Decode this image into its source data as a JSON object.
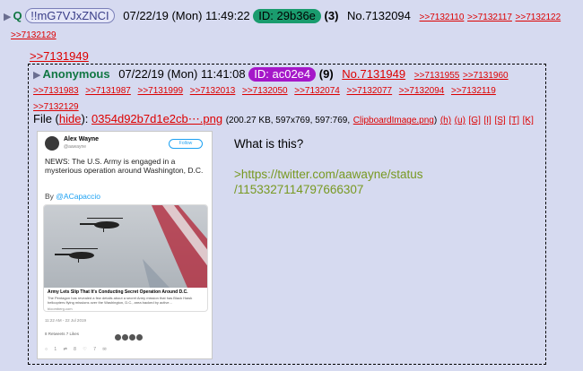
{
  "post": {
    "q_label": "Q",
    "tripcode": "!!mG7VJxZNCI",
    "date": "07/22/19 (Mon) 11:49:22",
    "id_label": "ID: 29b36e",
    "id_count": "(3)",
    "number": "No.7132094",
    "backlinks": [
      ">>7132110",
      ">>7132117",
      ">>7132122",
      ">>7132129"
    ],
    "quote_link": ">>7131949"
  },
  "quoted": {
    "name": "Anonymous",
    "date": "07/22/19 (Mon) 11:41:08",
    "id_label": "ID: ac02e4",
    "id_count": "(9)",
    "number": "No.7131949",
    "backlinks": [
      ">>7131955",
      ">>7131960",
      ">>7131983",
      ">>7131987",
      ">>7131999",
      ">>7132013",
      ">>7132050",
      ">>7132074",
      ">>7132077",
      ">>7132094",
      ">>7132119",
      ">>7132129"
    ],
    "file": {
      "prefix": "File (",
      "hide": "hide",
      "suffix": "):",
      "filename": "0354d92b7d1e2cb⋯.png",
      "meta_open": "(200.27 KB, 597x769, 597:769,",
      "original_name": "ClipboardImage.png",
      "meta_close": ")",
      "tools": [
        "(h)",
        "(u)",
        "[G]",
        "[I]",
        "[S]",
        "[T]",
        "[K]"
      ]
    },
    "comment_line1": "What is this?",
    "comment_link_line1": ">https://twitter.com/aawayne/status",
    "comment_link_line2": "/1153327114797666307"
  },
  "tweet": {
    "author": "Alex Wayne",
    "handle": "@aawayne",
    "follow_label": "Follow",
    "text": "NEWS: The U.S. Army is engaged in a mysterious operation around Washington, D.C.",
    "by_prefix": "By ",
    "by_handle": "@ACapaccio",
    "card_title": "Army Lets Slip That It's Conducting Secret Operation Around D.C.",
    "card_desc": "The Pentagon has revealed a few details about a secret Army mission that has Black Hawk helicopters flying missions over the Washington, D.C., area backed by active...",
    "card_site": "bloomberg.com",
    "time": "11:22 AM - 22 Jul 2019",
    "stats": "8 Retweets  7 Likes",
    "actions": "○ 1   ⇄ 8   ♡ 7   ✉"
  },
  "colors": {
    "background": "#d6daf0",
    "link": "#dd0000",
    "name": "#117743",
    "greentext": "#789922",
    "id_green": "#1a9c6e",
    "id_purple": "#a517c9"
  }
}
